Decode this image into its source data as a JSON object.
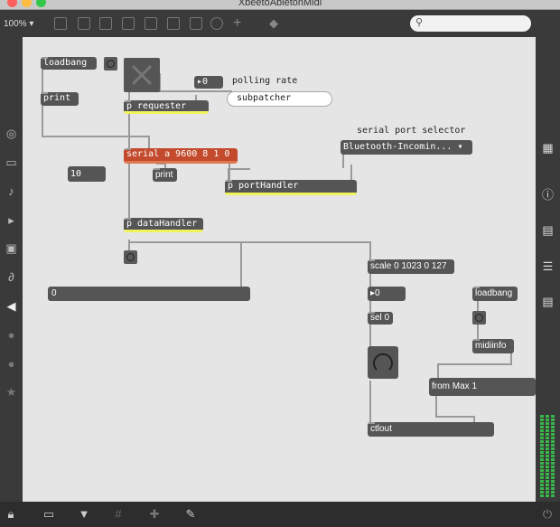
{
  "window": {
    "title": "XbeetoAbletonMidi",
    "zoom": "100%"
  },
  "icons": {
    "search": "search-icon",
    "lock": "lock-icon",
    "presentation": "presentation-icon",
    "grid": "grid-icon",
    "debug": "debug-icon",
    "wrench": "wrench-icon",
    "power": "power-icon",
    "info": "info-icon"
  },
  "patch": {
    "loadbang_top": "loadbang",
    "print_top": "print",
    "number_polling": "0",
    "polling_comment": "polling rate",
    "subpatcher_msg": "subpatcher",
    "requester": "p requester",
    "serial_port_comment": "serial port selector",
    "serial_obj": "serial a 9600 8 1 0",
    "number_10": "10",
    "print_mid": "print",
    "port_menu": "Bluetooth-Incomin...",
    "port_handler": "p portHandler",
    "data_handler": "p dataHandler",
    "slider_value": "0",
    "scale_obj": "scale 0 1023 0 127",
    "number_scaled": "0",
    "sel_obj": "sel 0",
    "loadbang_midi": "loadbang",
    "midiinfo": "midiinfo",
    "menu_midi": "from Max 1",
    "ctlout": "ctlout"
  },
  "colors": {
    "accent_selected": "#f1f35c",
    "serial_box": "#c34a2c",
    "meter": "#39b54a"
  }
}
